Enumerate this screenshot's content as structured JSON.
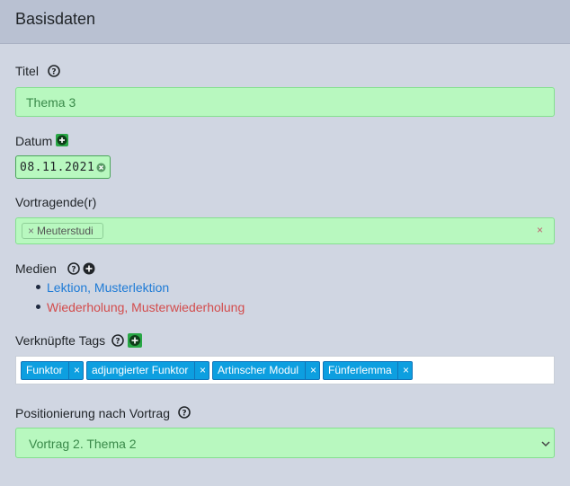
{
  "header": {
    "title": "Basisdaten"
  },
  "title_field": {
    "label": "Titel",
    "value": "Thema 3"
  },
  "date_field": {
    "label": "Datum",
    "value": "08.11.2021"
  },
  "speakers_field": {
    "label": "Vortragende(r)",
    "chips": [
      "Meuterstudi"
    ],
    "clear": "×",
    "chip_remove": "×"
  },
  "media": {
    "label": "Medien",
    "items": [
      {
        "text": "Lektion, Musterlektion",
        "color": "#1e7bd6"
      },
      {
        "text": "Wiederholung, Musterwiederholung",
        "color": "#d34c4c"
      }
    ]
  },
  "tags": {
    "label": "Verknüpfte Tags",
    "remove": "×",
    "items": [
      "Funktor",
      "adjungierter Funktor",
      "Artinscher Modul",
      "Fünferlemma"
    ]
  },
  "position": {
    "label": "Positionierung nach Vortrag",
    "selected": "Vortrag 2. Thema 2"
  },
  "colors": {
    "accent_green": "#28a745",
    "tag_blue": "#0d9fe0",
    "field_green": "#b8f8bf"
  }
}
